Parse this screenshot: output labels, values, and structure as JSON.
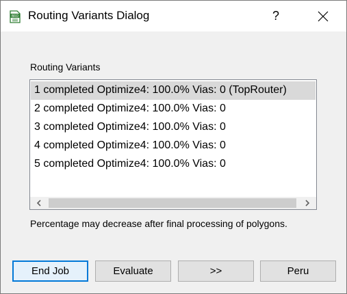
{
  "window": {
    "title": "Routing Variants Dialog",
    "icon_label": "BRD",
    "help_label": "?",
    "icons": {
      "app": "brd-document-icon",
      "close": "close-icon"
    }
  },
  "variants": {
    "label": "Routing Variants",
    "items": [
      "1 completed Optimize4:  100.0%  Vias: 0 (TopRouter)",
      "2 completed Optimize4:  100.0%  Vias: 0",
      "3 completed Optimize4:  100.0%  Vias: 0",
      "4 completed Optimize4:  100.0%  Vias: 0",
      "5 completed Optimize4:  100.0%  Vias: 0"
    ],
    "selected_index": 0
  },
  "note": "Percentage may decrease after final processing of polygons.",
  "buttons": {
    "end_job": "End Job",
    "evaluate": "Evaluate",
    "next": ">>",
    "peru": "Peru"
  },
  "colors": {
    "accent": "#0078d7",
    "selection": "#d9d9d9",
    "face": "#f0f0f0"
  }
}
